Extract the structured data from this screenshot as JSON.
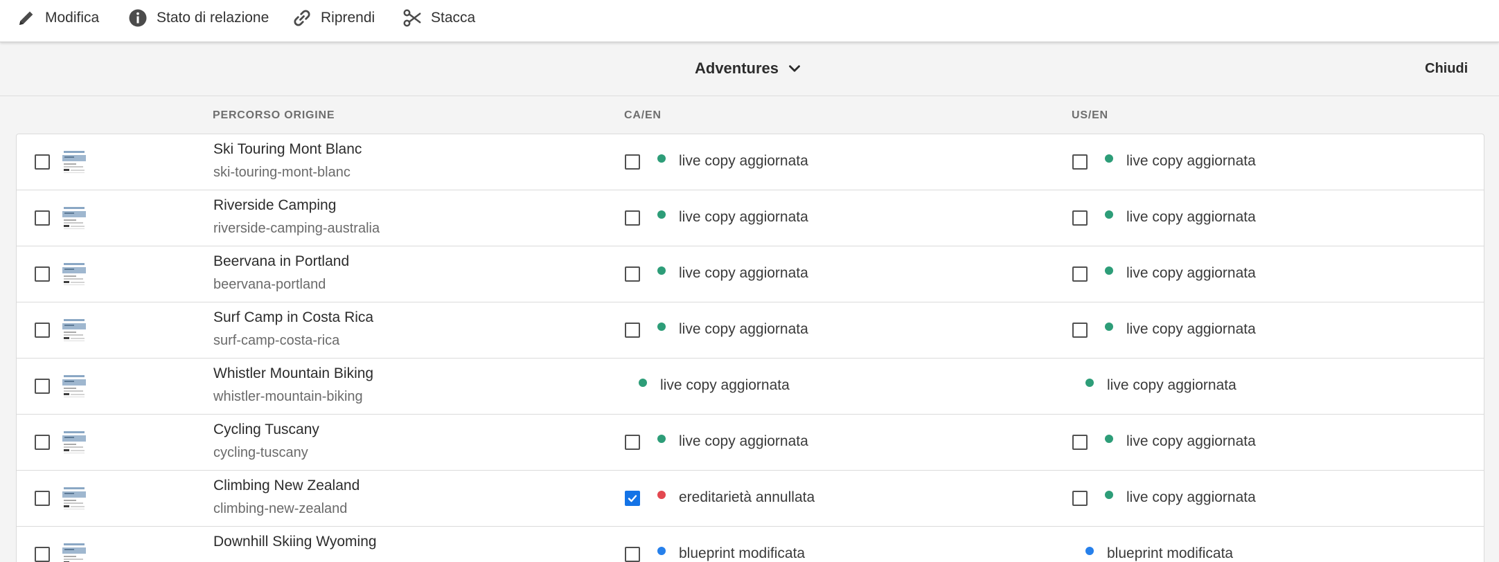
{
  "toolbar": {
    "edit_label": "Modifica",
    "relation_label": "Stato di relazione",
    "resume_label": "Riprendi",
    "detach_label": "Stacca"
  },
  "header": {
    "title": "Adventures",
    "close_label": "Chiudi"
  },
  "columns": {
    "source": "PERCORSO ORIGINE",
    "ca": "CA/EN",
    "us": "US/EN"
  },
  "colors": {
    "green": "#2d9d78",
    "red": "#e34850",
    "blue": "#2680eb",
    "accent": "#1473e6"
  },
  "rows": [
    {
      "title": "Ski Touring Mont Blanc",
      "path": "ski-touring-mont-blanc",
      "ca": {
        "status": "live copy aggiornata",
        "color": "green",
        "checkbox": true,
        "checked": false
      },
      "us": {
        "status": "live copy aggiornata",
        "color": "green",
        "checkbox": true,
        "checked": false
      }
    },
    {
      "title": "Riverside Camping",
      "path": "riverside-camping-australia",
      "ca": {
        "status": "live copy aggiornata",
        "color": "green",
        "checkbox": true,
        "checked": false
      },
      "us": {
        "status": "live copy aggiornata",
        "color": "green",
        "checkbox": true,
        "checked": false
      }
    },
    {
      "title": "Beervana in Portland",
      "path": "beervana-portland",
      "ca": {
        "status": "live copy aggiornata",
        "color": "green",
        "checkbox": true,
        "checked": false
      },
      "us": {
        "status": "live copy aggiornata",
        "color": "green",
        "checkbox": true,
        "checked": false
      }
    },
    {
      "title": "Surf Camp in Costa Rica",
      "path": "surf-camp-costa-rica",
      "ca": {
        "status": "live copy aggiornata",
        "color": "green",
        "checkbox": true,
        "checked": false
      },
      "us": {
        "status": "live copy aggiornata",
        "color": "green",
        "checkbox": true,
        "checked": false
      }
    },
    {
      "title": "Whistler Mountain Biking",
      "path": "whistler-mountain-biking",
      "ca": {
        "status": "live copy aggiornata",
        "color": "green",
        "checkbox": false,
        "checked": false
      },
      "us": {
        "status": "live copy aggiornata",
        "color": "green",
        "checkbox": false,
        "checked": false
      }
    },
    {
      "title": "Cycling Tuscany",
      "path": "cycling-tuscany",
      "ca": {
        "status": "live copy aggiornata",
        "color": "green",
        "checkbox": true,
        "checked": false
      },
      "us": {
        "status": "live copy aggiornata",
        "color": "green",
        "checkbox": true,
        "checked": false
      }
    },
    {
      "title": "Climbing New Zealand",
      "path": "climbing-new-zealand",
      "ca": {
        "status": "ereditarietà annullata",
        "color": "red",
        "checkbox": true,
        "checked": true
      },
      "us": {
        "status": "live copy aggiornata",
        "color": "green",
        "checkbox": true,
        "checked": false
      }
    },
    {
      "title": "Downhill Skiing Wyoming",
      "path": "",
      "ca": {
        "status": "blueprint modificata",
        "color": "blue",
        "checkbox": true,
        "checked": false
      },
      "us": {
        "status": "blueprint modificata",
        "color": "blue",
        "checkbox": false,
        "checked": false
      }
    }
  ]
}
